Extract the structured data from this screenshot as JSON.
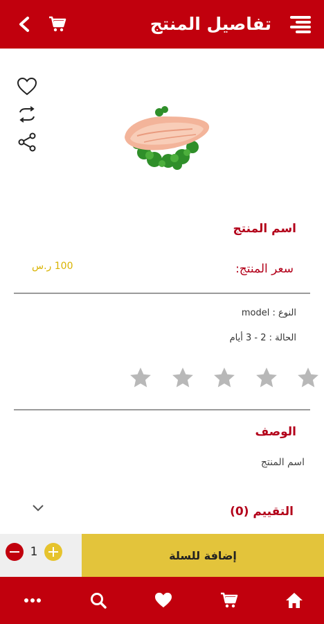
{
  "header": {
    "title": "تفاصيل المنتج",
    "back_icon": "chevron-left-icon",
    "cart_icon": "cart-icon",
    "menu_icon": "menu-lines-icon",
    "color": "#c1000d"
  },
  "product": {
    "actions": [
      {
        "icon": "heart-outline-icon"
      },
      {
        "icon": "compare-arrows-icon"
      },
      {
        "icon": "share-icon"
      }
    ],
    "image_icon": "chicken-breast-image",
    "name": "اسم المنتج",
    "price_label": "سعر المنتج:",
    "price_value": "100 ر.س",
    "type_line": "النوع : model",
    "status_line": "الحالة : 2 - 3 أيام",
    "rating_value": 0,
    "rating_max": 5,
    "star_color": "#b8b8b8"
  },
  "description": {
    "title": "الوصف",
    "text": "اسم المنتج"
  },
  "reviews": {
    "title": "التقييم (0)",
    "chevron_icon": "chevron-down-icon"
  },
  "cart_bar": {
    "quantity": "1",
    "add_label": "إضافة للسلة",
    "minus_color": "#c1000d",
    "plus_color": "#e6c32d",
    "button_color": "#e3c43b"
  },
  "bottom_nav": {
    "items": [
      {
        "icon": "more-dots-icon"
      },
      {
        "icon": "search-icon"
      },
      {
        "icon": "heart-icon"
      },
      {
        "icon": "cart-icon"
      },
      {
        "icon": "home-icon"
      }
    ]
  },
  "colors": {
    "accent_red": "#b3001a",
    "price_yellow": "#d9b300"
  }
}
